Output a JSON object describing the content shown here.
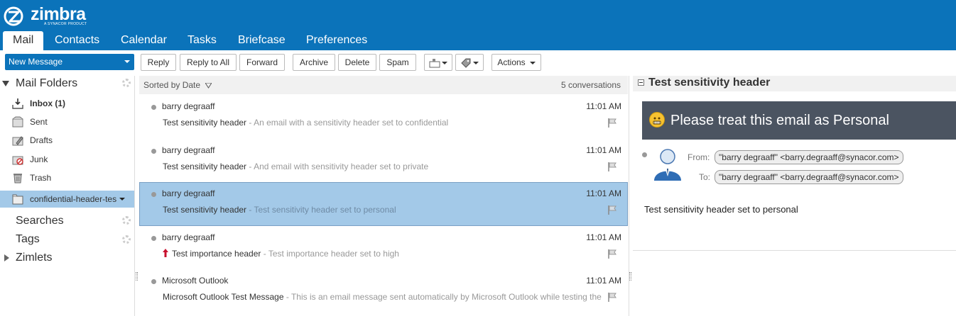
{
  "brand": {
    "name": "zimbra",
    "tagline": "A SYNACOR PRODUCT"
  },
  "nav": {
    "tabs": [
      {
        "label": "Mail",
        "active": true
      },
      {
        "label": "Contacts"
      },
      {
        "label": "Calendar"
      },
      {
        "label": "Tasks"
      },
      {
        "label": "Briefcase"
      },
      {
        "label": "Preferences"
      }
    ]
  },
  "toolbar": {
    "new_message": "New Message",
    "reply": "Reply",
    "reply_all": "Reply to All",
    "forward": "Forward",
    "archive": "Archive",
    "delete": "Delete",
    "spam": "Spam",
    "actions": "Actions"
  },
  "sidebar": {
    "mail_folders": "Mail Folders",
    "folders": [
      {
        "label": "Inbox (1)",
        "icon": "inbox-icon",
        "bold": true
      },
      {
        "label": "Sent",
        "icon": "sent-icon"
      },
      {
        "label": "Drafts",
        "icon": "drafts-icon"
      },
      {
        "label": "Junk",
        "icon": "junk-icon"
      },
      {
        "label": "Trash",
        "icon": "trash-icon"
      },
      {
        "label": "confidential-header-tes",
        "icon": "folder-icon",
        "selected": true
      }
    ],
    "searches": "Searches",
    "tags": "Tags",
    "zimlets": "Zimlets"
  },
  "list": {
    "sort_label": "Sorted by Date",
    "count": "5 conversations",
    "rows": [
      {
        "sender": "barry degraaff",
        "time": "11:01 AM",
        "subject": "Test sensitivity header",
        "fragment": " - An email with a sensitivity header set to confidential"
      },
      {
        "sender": "barry degraaff",
        "time": "11:01 AM",
        "subject": "Test sensitivity header",
        "fragment": " - And email with sensitivity header set to private"
      },
      {
        "sender": "barry degraaff",
        "time": "11:01 AM",
        "subject": "Test sensitivity header",
        "fragment": " - Test sensitivity header set to personal",
        "selected": true
      },
      {
        "sender": "barry degraaff",
        "time": "11:01 AM",
        "subject": "Test importance header",
        "fragment": " - Test importance header set to high",
        "high_priority": true
      },
      {
        "sender": "Microsoft Outlook",
        "time": "11:01 AM",
        "subject": "Microsoft Outlook Test Message",
        "fragment": " - This is an email message sent automatically by Microsoft Outlook while testing the"
      }
    ]
  },
  "reading": {
    "title": "Test sensitivity header",
    "banner": "Please treat this email as Personal",
    "from_label": "From:",
    "to_label": "To:",
    "from": "\"barry degraaff\" <barry.degraaff@synacor.com>",
    "to": "\"barry degraaff\" <barry.degraaff@synacor.com>",
    "body": "Test sensitivity header set to personal"
  },
  "colors": {
    "brand_blue": "#0b73ba",
    "selection": "#a3c9e8",
    "banner": "#4b5461"
  }
}
